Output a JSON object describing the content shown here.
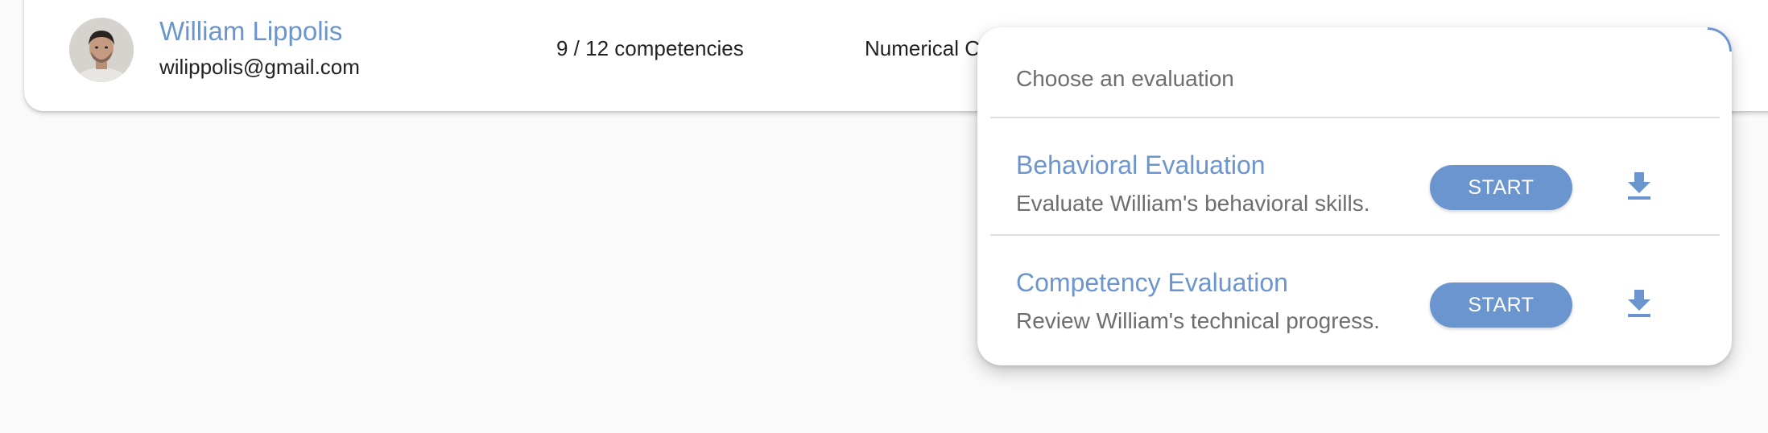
{
  "employee": {
    "name": "William Lippolis",
    "email": "wilippolis@gmail.com",
    "competencies": "9 / 12 competencies",
    "column_partial": "Numerical C",
    "avatar": "person-avatar"
  },
  "dropdown": {
    "title": "Choose an evaluation",
    "items": [
      {
        "title": "Behavioral Evaluation",
        "description": "Evaluate William's behavioral skills.",
        "start_label": "START",
        "download_icon": "download-icon"
      },
      {
        "title": "Competency Evaluation",
        "description": "Review William's technical progress.",
        "start_label": "START",
        "download_icon": "download-icon"
      }
    ]
  },
  "colors": {
    "accent": "#6b95cf",
    "text_dark": "#222222",
    "text_muted": "#6e6e6e",
    "background": "#fafafa"
  }
}
